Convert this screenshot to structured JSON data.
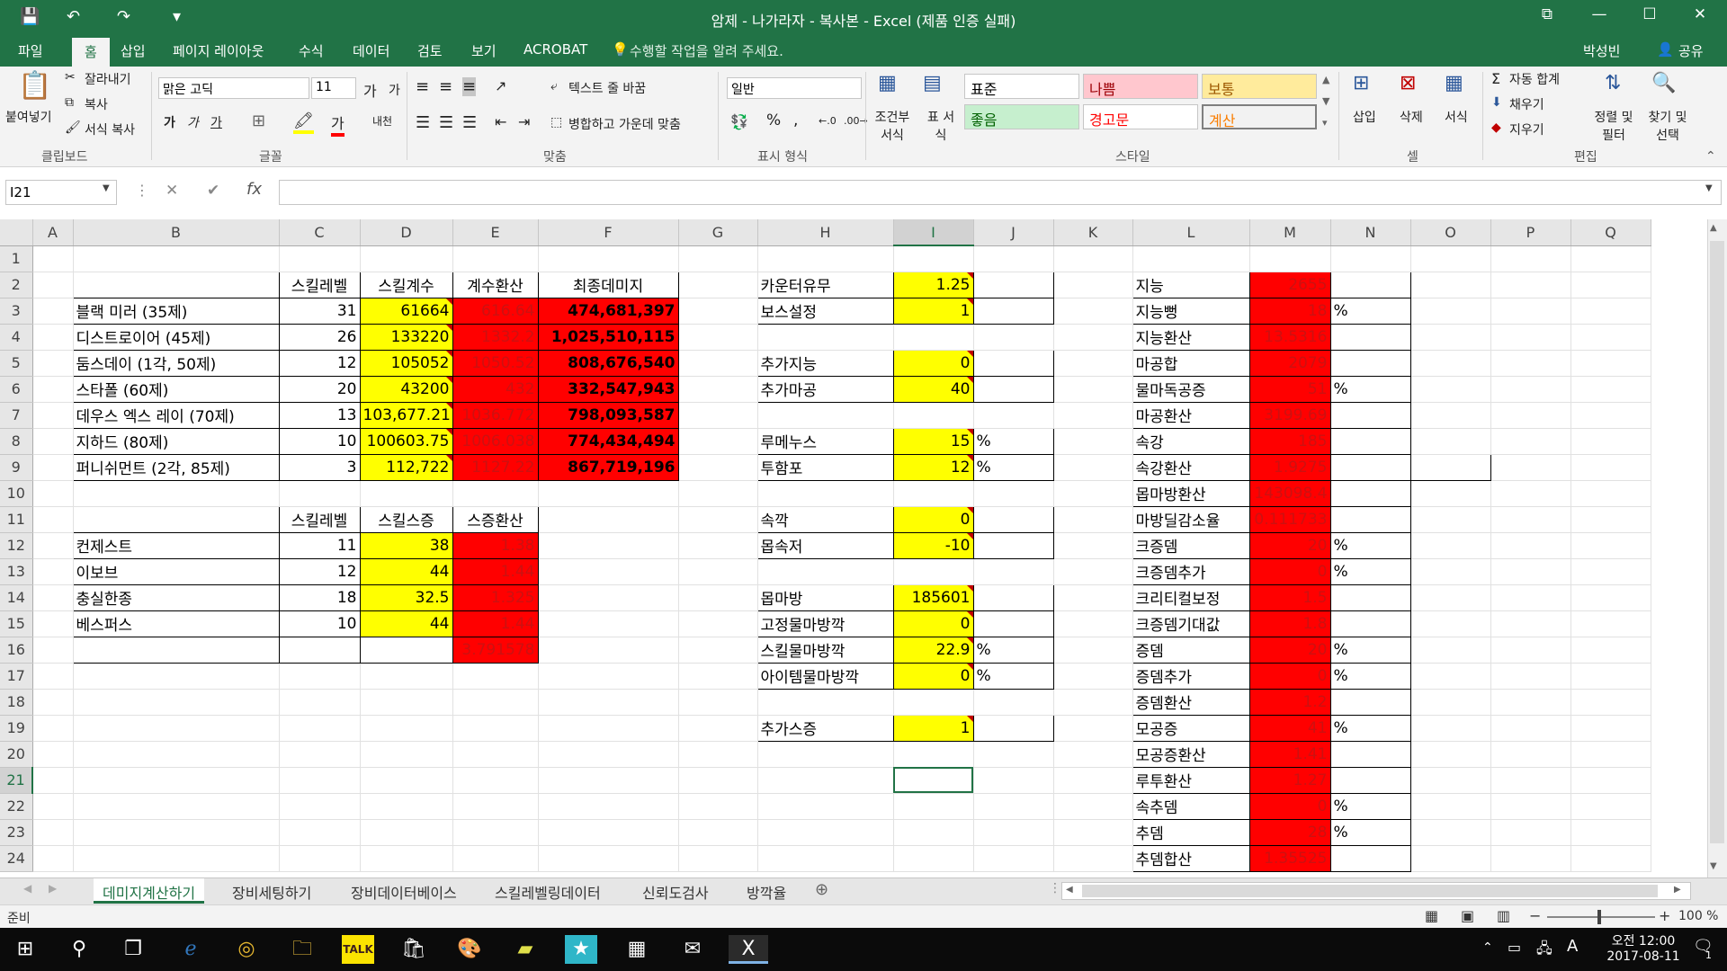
{
  "window": {
    "title": "암제 - 나가라자 - 복사본 - Excel (제품 인증 실패)",
    "controls": {
      "restore": "⧉",
      "min": "—",
      "max": "☐",
      "close": "✕"
    }
  },
  "qat": {
    "save": "💾",
    "undo": "↶",
    "redo": "↷",
    "more": "▾"
  },
  "ribbon_tabs": [
    "파일",
    "홈",
    "삽입",
    "페이지 레이아웃",
    "수식",
    "데이터",
    "검토",
    "보기",
    "ACROBAT"
  ],
  "tell_me": "수행할 작업을 알려 주세요.",
  "user": "박성빈",
  "share": "공유",
  "ribbon": {
    "clipboard": {
      "paste": "붙여넣기",
      "cut": "잘라내기",
      "copy": "복사",
      "format_painter": "서식 복사",
      "label": "클립보드"
    },
    "font": {
      "name": "맑은 고딕",
      "size": "11",
      "grow": "가",
      "shrink": "가",
      "bold": "가",
      "italic": "가",
      "underline": "가",
      "color_a": "가",
      "phonetic": "내천",
      "label": "글꼴"
    },
    "align": {
      "wrap": "텍스트 줄 바꿈",
      "merge": "병합하고 가운데 맞춤",
      "label": "맞춤"
    },
    "number": {
      "format": "일반",
      "percent": "%",
      "comma": ",",
      "label": "표시 형식"
    },
    "styles": {
      "conditional": "조건부 서식",
      "table": "표 서식",
      "cells": [
        {
          "text": "표준",
          "bg": "#ffffff",
          "fg": "#000000"
        },
        {
          "text": "나쁨",
          "bg": "#ffc7ce",
          "fg": "#9c0006"
        },
        {
          "text": "보통",
          "bg": "#ffeb9c",
          "fg": "#9c5700"
        },
        {
          "text": "좋음",
          "bg": "#c6efce",
          "fg": "#006100"
        },
        {
          "text": "경고문",
          "bg": "#ffffff",
          "fg": "#ff0000"
        },
        {
          "text": "계산",
          "bg": "#f2f2f2",
          "fg": "#fa7d00"
        }
      ],
      "label": "스타일"
    },
    "cells": {
      "insert": "삽입",
      "delete": "삭제",
      "format": "서식",
      "label": "셀"
    },
    "editing": {
      "autosum": "자동 합계",
      "fill": "채우기",
      "clear": "지우기",
      "sort": "정렬 및 필터",
      "find": "찾기 및 선택",
      "label": "편집"
    }
  },
  "formula_bar": {
    "name_box": "I21",
    "cancel": "✕",
    "enter": "✔",
    "fx": "fx",
    "value": ""
  },
  "columns": [
    "A",
    "B",
    "C",
    "D",
    "E",
    "F",
    "G",
    "H",
    "I",
    "J",
    "K",
    "L",
    "M",
    "N",
    "O",
    "P",
    "Q"
  ],
  "selected_cell": "I21",
  "table1": {
    "headers": [
      "스킬레벨",
      "스킬계수",
      "계수환산",
      "최종데미지"
    ],
    "rows": [
      [
        "블랙 미러 (35제)",
        "31",
        "61664",
        "616.64",
        "474,681,397"
      ],
      [
        "디스트로이어 (45제)",
        "26",
        "133220",
        "1332.2",
        "1,025,510,115"
      ],
      [
        "둠스데이 (1각, 50제)",
        "12",
        "105052",
        "1050.52",
        "808,676,540"
      ],
      [
        "스타폴 (60제)",
        "20",
        "43200",
        "432",
        "332,547,943"
      ],
      [
        "데우스 엑스 레이 (70제)",
        "13",
        "103,677.21",
        "1036.772",
        "798,093,587"
      ],
      [
        "지하드 (80제)",
        "10",
        "100603.75",
        "1006.038",
        "774,434,494"
      ],
      [
        "퍼니쉬먼트 (2각, 85제)",
        "3",
        "112,722",
        "1127.22",
        "867,719,196"
      ]
    ]
  },
  "table2": {
    "headers": [
      "스킬레벨",
      "스킬스증",
      "스증환산"
    ],
    "rows": [
      [
        "컨제스트",
        "11",
        "38",
        "1.38"
      ],
      [
        "이보브",
        "12",
        "44",
        "1.44"
      ],
      [
        "충실한종",
        "18",
        "32.5",
        "1.325"
      ],
      [
        "베스퍼스",
        "10",
        "44",
        "1.44"
      ]
    ],
    "total": "3.791578"
  },
  "params": {
    "r2": [
      "카운터유무",
      "1.25"
    ],
    "r3": [
      "보스설정",
      "1"
    ],
    "r5": [
      "추가지능",
      "0"
    ],
    "r6": [
      "추가마공",
      "40"
    ],
    "r8": [
      "루메누스",
      "15",
      "%"
    ],
    "r9": [
      "투함포",
      "12",
      "%"
    ],
    "r11": [
      "속깍",
      "0"
    ],
    "r12": [
      "몹속저",
      "-10"
    ],
    "r14": [
      "몹마방",
      "185601"
    ],
    "r15": [
      "고정물마방깍",
      "0"
    ],
    "r16": [
      "스킬물마방깍",
      "22.9",
      "%"
    ],
    "r17": [
      "아이템물마방깍",
      "0",
      "%"
    ],
    "r19": [
      "추가스증",
      "1"
    ]
  },
  "stats": [
    [
      "지능",
      "2655",
      ""
    ],
    [
      "지능뻥",
      "18",
      "%"
    ],
    [
      "지능환산",
      "13.5316",
      ""
    ],
    [
      "마공합",
      "2079",
      ""
    ],
    [
      "물마독공증",
      "51",
      "%"
    ],
    [
      "마공환산",
      "3199.69",
      ""
    ],
    [
      "속강",
      "185",
      ""
    ],
    [
      "속강환산",
      "1.9275",
      ""
    ],
    [
      "몹마방환산",
      "143098.4",
      ""
    ],
    [
      "마방딜감소율",
      "0.111733",
      ""
    ],
    [
      "크증뎀",
      "20",
      "%"
    ],
    [
      "크증뎀추가",
      "0",
      "%"
    ],
    [
      "크리티컬보정",
      "1.5",
      ""
    ],
    [
      "크증뎀기대값",
      "1.8",
      ""
    ],
    [
      "증뎀",
      "20",
      "%"
    ],
    [
      "증뎀추가",
      "0",
      "%"
    ],
    [
      "증뎀환산",
      "1.2",
      ""
    ],
    [
      "모공증",
      "41",
      "%"
    ],
    [
      "모공증환산",
      "1.41",
      ""
    ],
    [
      "루투환산",
      "1.27",
      ""
    ],
    [
      "속추뎀",
      "0",
      "%"
    ],
    [
      "추뎀",
      "28",
      "%"
    ],
    [
      "추뎀합산",
      "1.35525",
      ""
    ]
  ],
  "sheet_tabs": [
    "데미지계산하기",
    "장비세팅하기",
    "장비데이터베이스",
    "스킬레벨링데이터",
    "신뢰도검사",
    "방깍율"
  ],
  "active_sheet": "데미지계산하기",
  "status": {
    "ready": "준비",
    "zoom": "100 %"
  },
  "taskbar": {
    "icons": [
      "windows-icon",
      "search-icon",
      "taskview-icon",
      "edge-icon",
      "chrome-icon",
      "explorer-icon",
      "kakaotalk-icon",
      "store-icon",
      "paint-icon",
      "note-icon",
      "star-icon",
      "calculator-icon",
      "mail-icon",
      "excel-icon"
    ],
    "ime": "A",
    "time": "오전 12:00",
    "date": "2017-08-11",
    "notif_count": "1"
  },
  "colors": {
    "excel_green": "#217346",
    "yellow": "#ffff00",
    "red": "#ff0000"
  }
}
